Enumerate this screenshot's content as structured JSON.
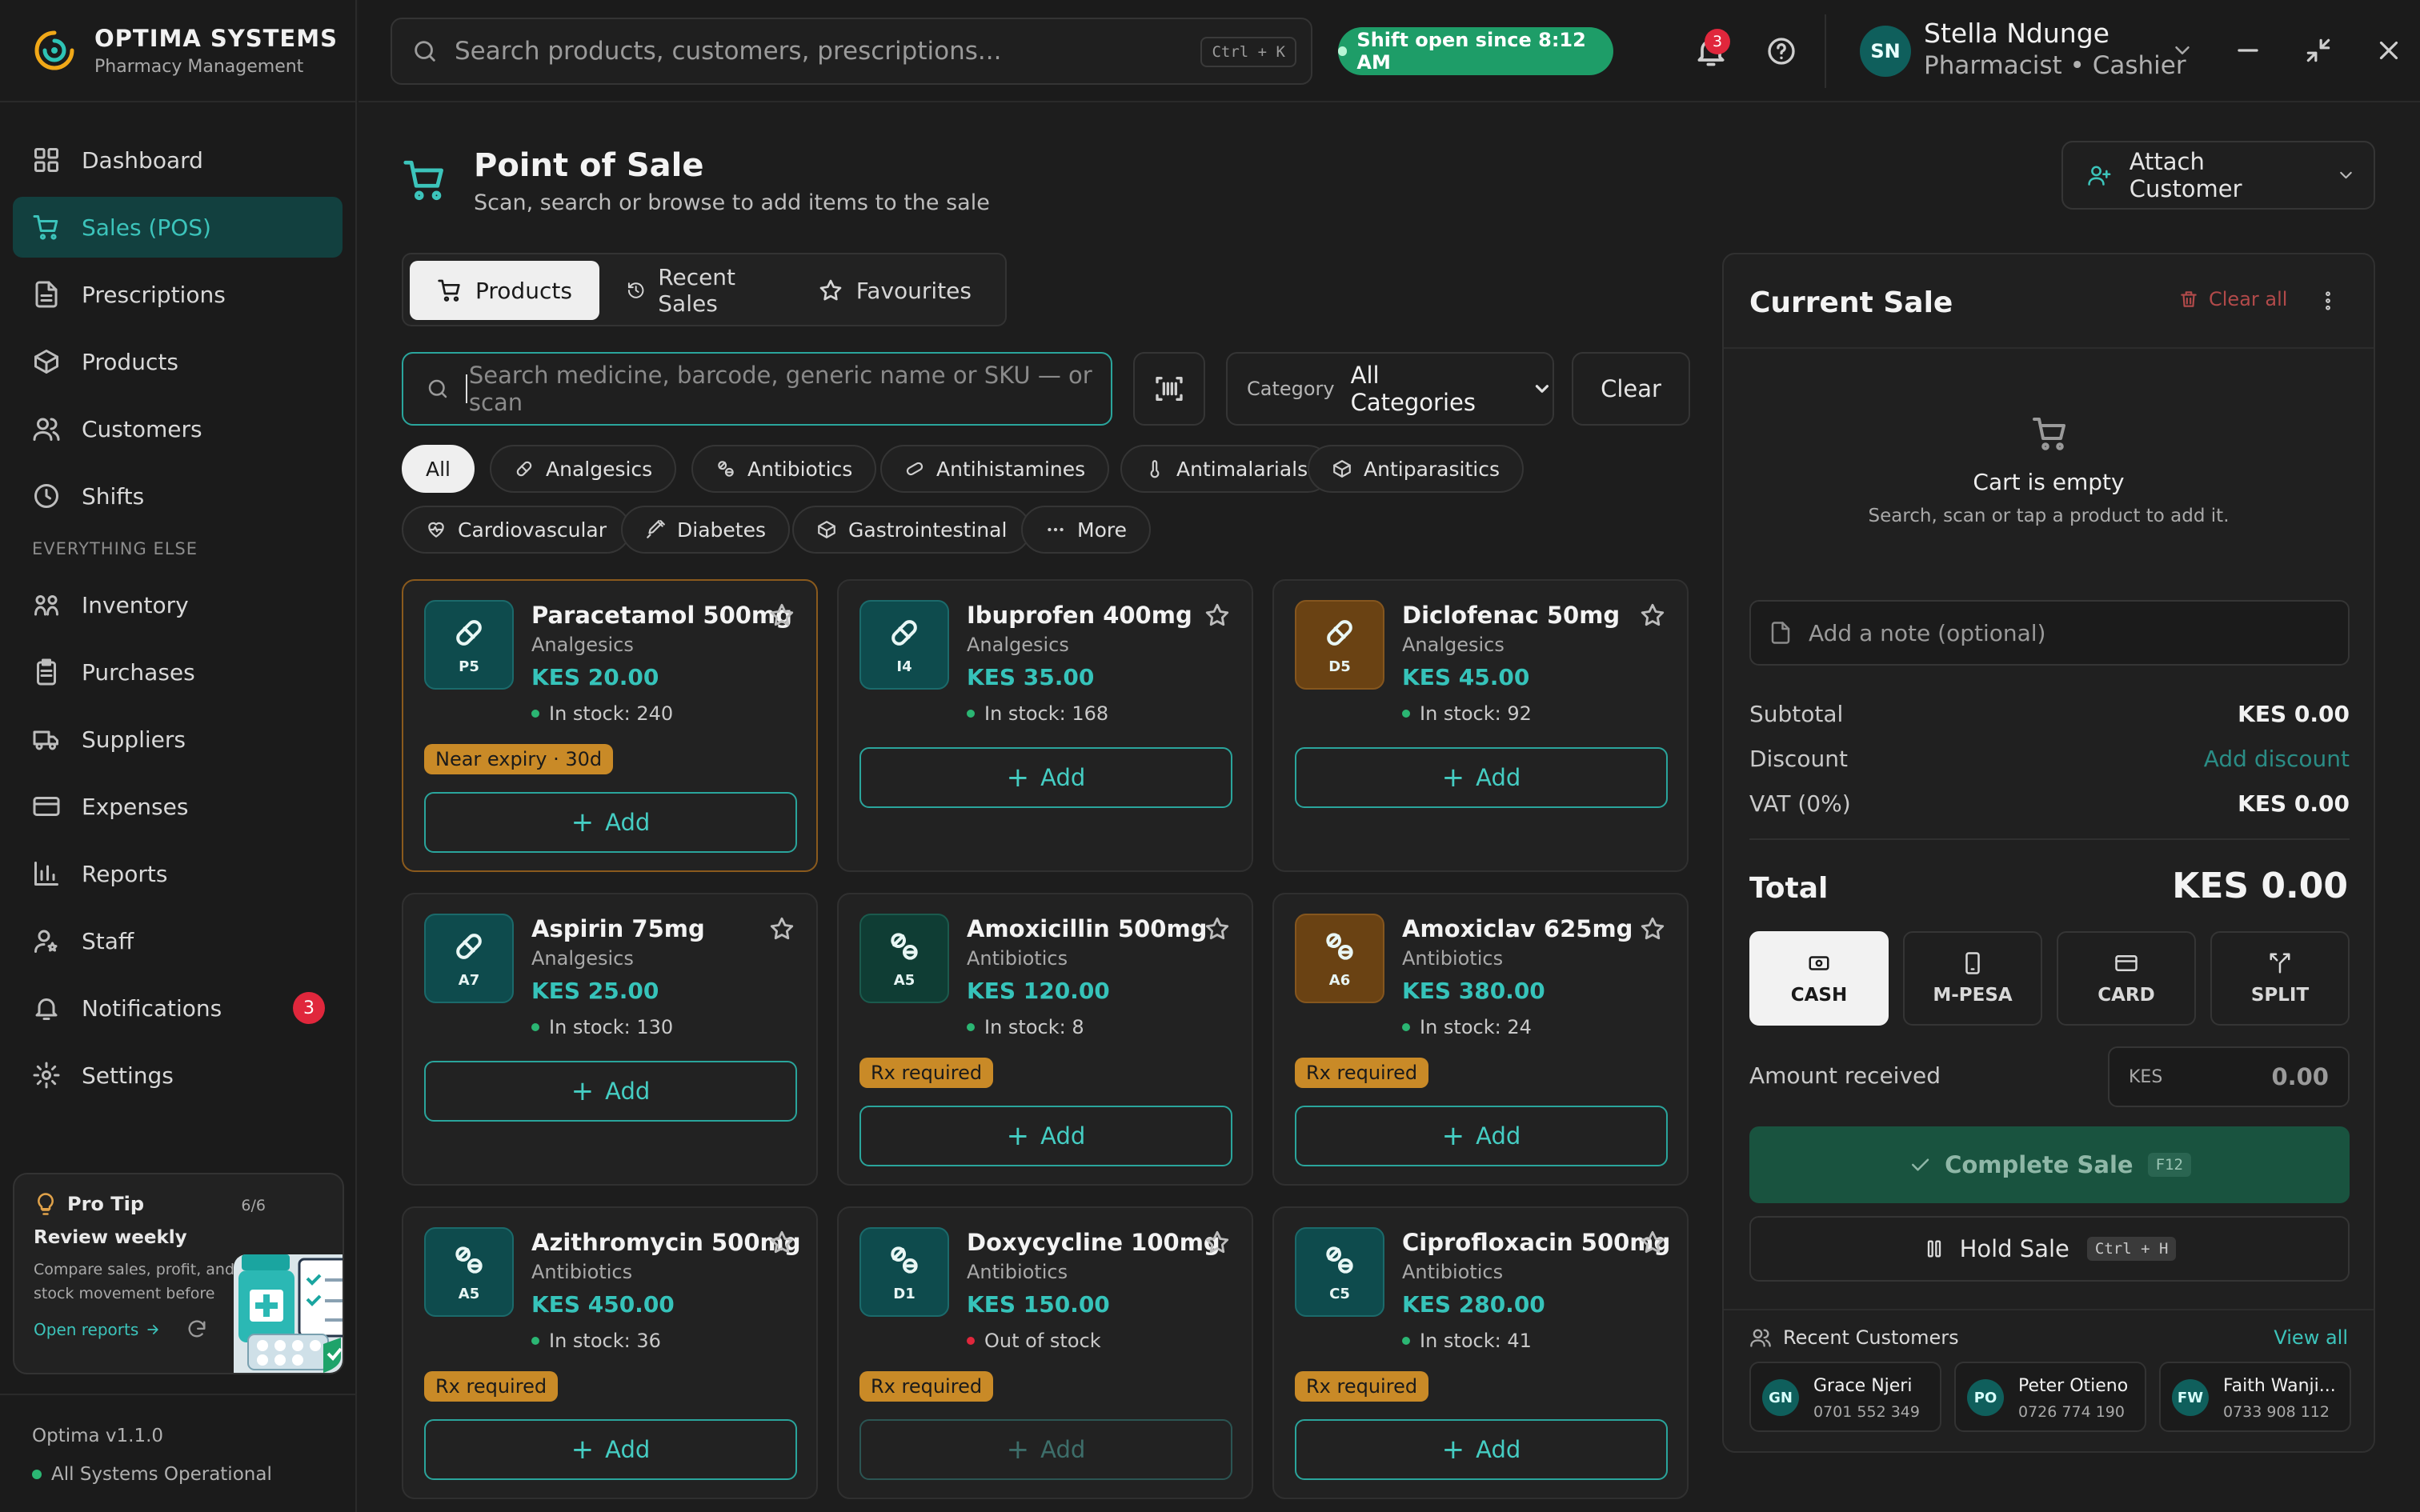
{
  "brand": {
    "name": "OPTIMA SYSTEMS",
    "subtitle": "Pharmacy Management"
  },
  "topbar": {
    "search_placeholder": "Search products, customers, prescriptions...",
    "search_shortcut": "Ctrl + K",
    "shift_status": "Shift open since 8:12 AM",
    "notification_count": "3",
    "user": {
      "initials": "SN",
      "name": "Stella Ndunge",
      "role": "Pharmacist • Cashier"
    }
  },
  "sidebar": {
    "items": [
      {
        "label": "Dashboard",
        "icon": "dashboard-icon"
      },
      {
        "label": "Sales (POS)",
        "icon": "cart-icon",
        "active": true
      },
      {
        "label": "Prescriptions",
        "icon": "document-icon"
      },
      {
        "label": "Products",
        "icon": "box-icon"
      },
      {
        "label": "Customers",
        "icon": "users-icon"
      },
      {
        "label": "Shifts",
        "icon": "clock-icon"
      }
    ],
    "section_label": "EVERYTHING ELSE",
    "items2": [
      {
        "label": "Inventory",
        "icon": "inventory-icon"
      },
      {
        "label": "Purchases",
        "icon": "clipboard-icon"
      },
      {
        "label": "Suppliers",
        "icon": "truck-icon"
      },
      {
        "label": "Expenses",
        "icon": "wallet-icon"
      },
      {
        "label": "Reports",
        "icon": "bar-chart-icon"
      },
      {
        "label": "Staff",
        "icon": "staff-icon"
      },
      {
        "label": "Notifications",
        "icon": "bell-icon",
        "badge": "3"
      },
      {
        "label": "Settings",
        "icon": "gear-icon"
      }
    ],
    "protip": {
      "label": "Pro Tip",
      "count": "6/6",
      "title": "Review weekly",
      "text": "Compare sales, profit, and stock movement before planning...",
      "link": "Open reports"
    },
    "version": "Optima v1.1.0",
    "status": "All Systems Operational"
  },
  "main": {
    "title": "Point of Sale",
    "subtitle": "Scan, search or browse to add items to the sale",
    "attach_customer": "Attach Customer",
    "tabs": [
      "Products",
      "Recent Sales",
      "Favourites"
    ],
    "product_search_placeholder": "Search medicine, barcode, generic name or SKU — or scan",
    "category_label": "Category",
    "category_value": "All Categories",
    "clear_label": "Clear",
    "chips": [
      "All",
      "Analgesics",
      "Antibiotics",
      "Antihistamines",
      "Antimalarials",
      "Antiparasitics",
      "Cardiovascular",
      "Diabetes",
      "Gastrointestinal",
      "More"
    ],
    "add_label": "Add",
    "products": [
      {
        "name": "Paracetamol 500mg",
        "category": "Analgesics",
        "price": "KES 20.00",
        "stock": "In stock: 240",
        "code": "P5",
        "badge": "Near expiry · 30d",
        "icon": "pill-icon",
        "color": "teal",
        "in_stock": true
      },
      {
        "name": "Ibuprofen 400mg",
        "category": "Analgesics",
        "price": "KES 35.00",
        "stock": "In stock: 168",
        "code": "I4",
        "badge": "",
        "icon": "pill-icon",
        "color": "teal",
        "in_stock": true
      },
      {
        "name": "Diclofenac 50mg",
        "category": "Analgesics",
        "price": "KES 45.00",
        "stock": "In stock: 92",
        "code": "D5",
        "badge": "",
        "icon": "pill-icon",
        "color": "brown",
        "in_stock": true
      },
      {
        "name": "Aspirin 75mg",
        "category": "Analgesics",
        "price": "KES 25.00",
        "stock": "In stock: 130",
        "code": "A7",
        "badge": "",
        "icon": "pill-icon",
        "color": "teal",
        "in_stock": true
      },
      {
        "name": "Amoxicillin 500mg",
        "category": "Antibiotics",
        "price": "KES 120.00",
        "stock": "In stock: 8",
        "code": "A5",
        "badge": "Rx required",
        "icon": "tablets-icon",
        "color": "green",
        "in_stock": true
      },
      {
        "name": "Amoxiclav 625mg",
        "category": "Antibiotics",
        "price": "KES 380.00",
        "stock": "In stock: 24",
        "code": "A6",
        "badge": "Rx required",
        "icon": "tablets-icon",
        "color": "brown",
        "in_stock": true
      },
      {
        "name": "Azithromycin 500mg",
        "category": "Antibiotics",
        "price": "KES 450.00",
        "stock": "In stock: 36",
        "code": "A5",
        "badge": "Rx required",
        "icon": "tablets-icon",
        "color": "teal",
        "in_stock": true
      },
      {
        "name": "Doxycycline 100mg",
        "category": "Antibiotics",
        "price": "KES 150.00",
        "stock": "Out of stock",
        "code": "D1",
        "badge": "Rx required",
        "icon": "tablets-icon",
        "color": "teal",
        "in_stock": false
      },
      {
        "name": "Ciprofloxacin 500mg",
        "category": "Antibiotics",
        "price": "KES 280.00",
        "stock": "In stock: 41",
        "code": "C5",
        "badge": "Rx required",
        "icon": "tablets-icon",
        "color": "teal",
        "in_stock": true
      }
    ]
  },
  "cart": {
    "title": "Current Sale",
    "clear_all": "Clear all",
    "empty_title": "Cart is empty",
    "empty_sub": "Search, scan or tap a product to add it.",
    "note_placeholder": "Add a note (optional)",
    "subtotal_label": "Subtotal",
    "subtotal": "KES 0.00",
    "discount_label": "Discount",
    "discount_action": "Add discount",
    "vat_label": "VAT (0%)",
    "vat": "KES 0.00",
    "total_label": "Total",
    "total": "KES 0.00",
    "payment_methods": [
      "CASH",
      "M-PESA",
      "CARD",
      "SPLIT"
    ],
    "amount_received_label": "Amount received",
    "amount_currency": "KES",
    "amount_value": "0.00",
    "complete_label": "Complete Sale",
    "complete_shortcut": "F12",
    "hold_label": "Hold Sale",
    "hold_shortcut": "Ctrl + H",
    "recent_title": "Recent Customers",
    "view_all": "View all",
    "recent_customers": [
      {
        "initials": "GN",
        "name": "Grace Njeri",
        "phone": "0701 552 349"
      },
      {
        "initials": "PO",
        "name": "Peter Otieno",
        "phone": "0726 774 190"
      },
      {
        "initials": "FW",
        "name": "Faith Wanji...",
        "phone": "0733 908 112"
      }
    ]
  },
  "colors": {
    "accent": "#3cc4bb",
    "active_nav_bg": "#12403f",
    "badge_red": "#e0273c",
    "rx_badge": "#c98a27",
    "shift_green": "#1e9d68"
  }
}
